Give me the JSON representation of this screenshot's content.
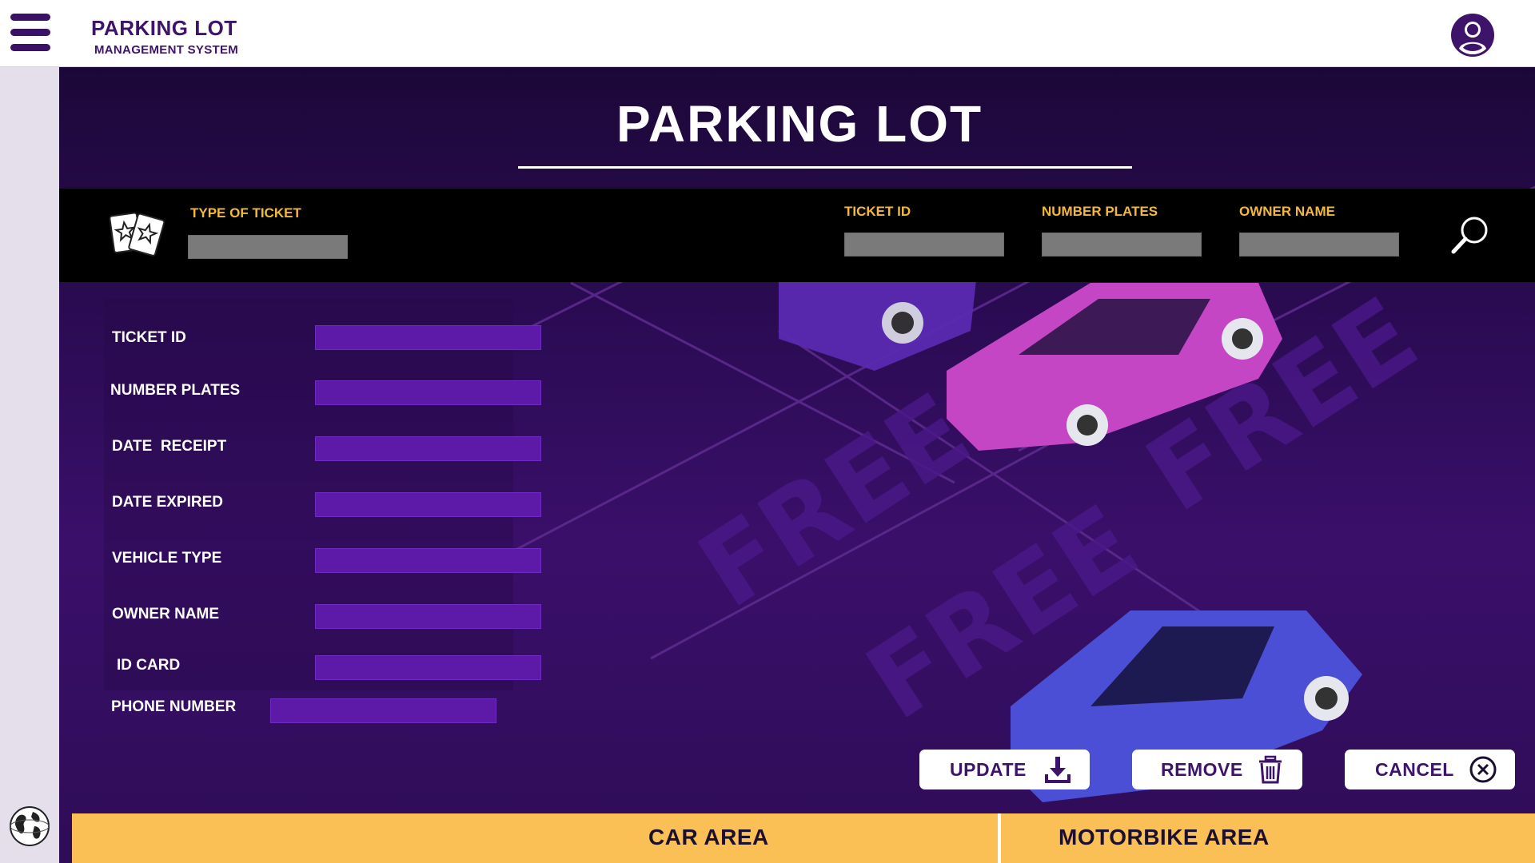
{
  "app": {
    "title": "PARKING LOT",
    "subtitle": "MANAGEMENT SYSTEM"
  },
  "page": {
    "title": "PARKING LOT"
  },
  "search": {
    "type_of_ticket_label": "TYPE OF TICKET",
    "type_of_ticket_value": "",
    "fields": [
      {
        "label": "TICKET ID",
        "value": ""
      },
      {
        "label": "NUMBER PLATES",
        "value": ""
      },
      {
        "label": "OWNER NAME",
        "value": ""
      }
    ]
  },
  "form": {
    "fields": [
      {
        "label": "TICKET ID",
        "value": ""
      },
      {
        "label": "NUMBER PLATES",
        "value": ""
      },
      {
        "label": "DATE  RECEIPT",
        "value": ""
      },
      {
        "label": "DATE EXPIRED",
        "value": ""
      },
      {
        "label": "VEHICLE TYPE",
        "value": ""
      },
      {
        "label": "OWNER NAME",
        "value": ""
      },
      {
        "label": "ID CARD",
        "value": ""
      },
      {
        "label": "PHONE NUMBER",
        "value": ""
      }
    ]
  },
  "actions": {
    "update": "UPDATE",
    "remove": "REMOVE",
    "cancel": "CANCEL"
  },
  "tabs": [
    {
      "label": "CAR AREA"
    },
    {
      "label": "MOTORBIKE AREA"
    }
  ],
  "background": {
    "parking_labels": [
      "FREE",
      "FREE",
      "FREE"
    ]
  },
  "colors": {
    "brand": "#3d1469",
    "accent": "#f3b93a",
    "tab_background": "#fbc055",
    "input_fill": "#5d1aa8",
    "search_strip": "#000000"
  },
  "icons": {
    "menu": "hamburger-menu-icon",
    "user": "user-account-icon",
    "ticket": "ticket-icon",
    "search": "magnifier-icon",
    "update": "download-icon",
    "remove": "trash-icon",
    "cancel": "close-circle-icon",
    "language": "globe-icon"
  }
}
